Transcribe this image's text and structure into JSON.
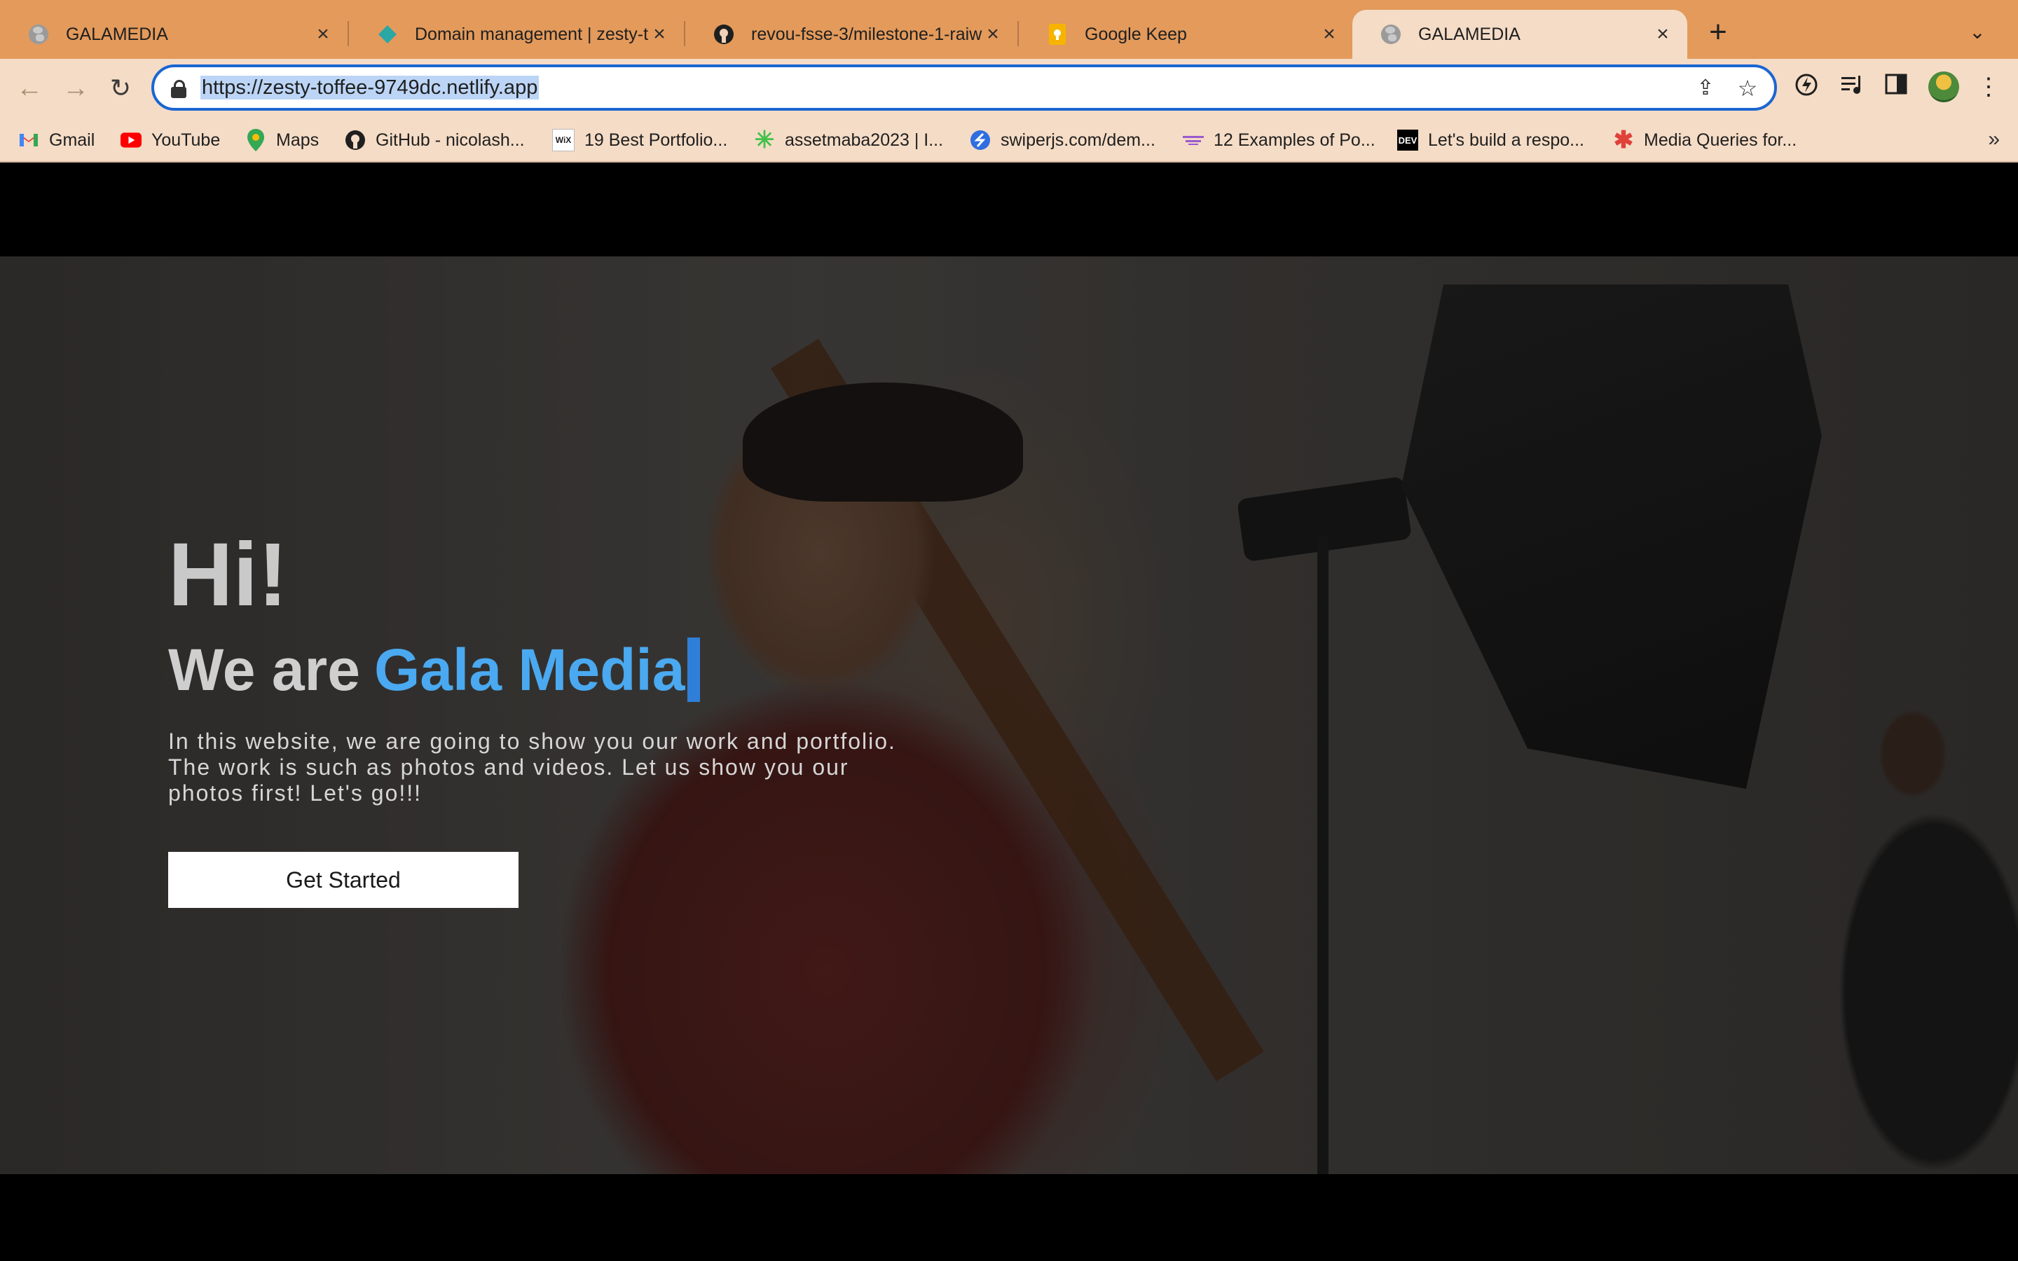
{
  "browser": {
    "tabs": [
      {
        "title": "GALAMEDIA",
        "favicon": "globe-icon",
        "active": false
      },
      {
        "title": "Domain management | zesty-t",
        "favicon": "netlify-icon",
        "active": false
      },
      {
        "title": "revou-fsse-3/milestone-1-raiw",
        "favicon": "github-icon",
        "active": false
      },
      {
        "title": "Google Keep",
        "favicon": "keep-icon",
        "active": false
      },
      {
        "title": "GALAMEDIA",
        "favicon": "globe-icon",
        "active": true
      }
    ],
    "url": "https://zesty-toffee-9749dc.netlify.app",
    "bookmarks": [
      {
        "label": "Gmail",
        "icon": "gmail-icon"
      },
      {
        "label": "YouTube",
        "icon": "youtube-icon"
      },
      {
        "label": "Maps",
        "icon": "maps-icon"
      },
      {
        "label": "GitHub - nicolash...",
        "icon": "github-icon"
      },
      {
        "label": "19 Best Portfolio...",
        "icon": "wix-icon"
      },
      {
        "label": "assetmaba2023 | I...",
        "icon": "asset-icon"
      },
      {
        "label": "swiperjs.com/dem...",
        "icon": "swiper-icon"
      },
      {
        "label": "12 Examples of Po...",
        "icon": "examples-icon"
      },
      {
        "label": "Let's build a respo...",
        "icon": "dev-icon"
      },
      {
        "label": "Media Queries for...",
        "icon": "asterisk-icon"
      }
    ],
    "bookmark_icon_text": {
      "wix": "WiX",
      "dev": "DEV"
    }
  },
  "hero": {
    "greeting": "Hi!",
    "headline_prefix": "We are",
    "headline_brand": "Gala Media",
    "intro": "In this website, we are going to show you our work and portfolio. The work is such as photos and videos. Let us show you our photos first! Let's go!!!",
    "cta_label": "Get Started"
  },
  "colors": {
    "tabstrip": "#e39a5b",
    "toolbar": "#f5dcc6",
    "brand_accent": "#4aa9f0",
    "omnibox_focus": "#1a66d2"
  }
}
